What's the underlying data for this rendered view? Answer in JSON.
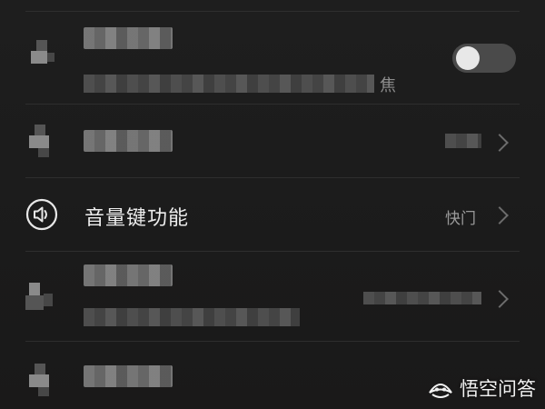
{
  "settings": {
    "rows": [
      {
        "id": "row1",
        "suffix": "焦"
      },
      {
        "id": "row2"
      },
      {
        "id": "volume-key",
        "label": "音量键功能",
        "value": "快门"
      },
      {
        "id": "row4"
      },
      {
        "id": "row5"
      }
    ],
    "toggle": {
      "state": "off"
    }
  },
  "watermark": {
    "text": "悟空问答"
  },
  "colors": {
    "background": "#1c1c1c",
    "text_primary": "#ededed",
    "text_secondary": "#9a9a9a",
    "divider": "#2e2e2e"
  },
  "icons": [
    "volume-icon",
    "chevron-right-icon",
    "wukong-logo-icon"
  ]
}
